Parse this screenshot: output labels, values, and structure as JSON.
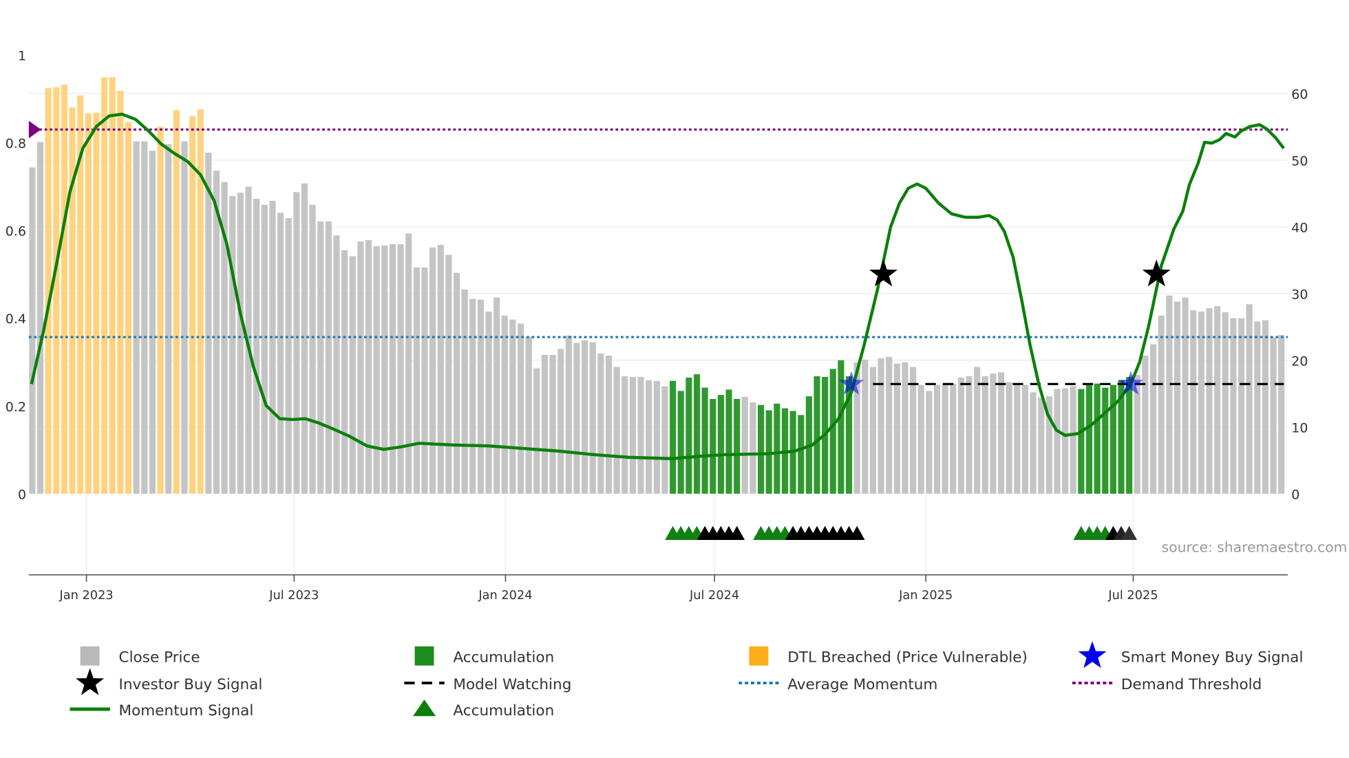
{
  "chart_data": {
    "type": "bar",
    "left_axis": {
      "ticks": [
        "0",
        "0.2",
        "0.4",
        "0.6",
        "0.8",
        "1"
      ],
      "range": [
        0,
        1
      ]
    },
    "right_axis": {
      "ticks": [
        "0",
        "10",
        "20",
        "30",
        "40",
        "50",
        "60"
      ],
      "range": [
        0,
        65.8
      ]
    },
    "x_ticks": [
      {
        "label": "Jan 2023",
        "week": 6.76
      },
      {
        "label": "Jul 2023",
        "week": 32.7
      },
      {
        "label": "Jan 2024",
        "week": 59.1
      },
      {
        "label": "Jul 2024",
        "week": 85.2
      },
      {
        "label": "Jan 2025",
        "week": 111.6
      },
      {
        "label": "Jul 2025",
        "week": 137.5
      }
    ],
    "close_price": [
      48.9,
      52.7,
      60.8,
      60.9,
      61.3,
      57.9,
      59.7,
      57,
      57.1,
      62.4,
      62.4,
      60.4,
      55.7,
      52.8,
      52.8,
      51.4,
      55,
      52.4,
      57.5,
      52.8,
      56.6,
      57.6,
      51.1,
      48.4,
      46.7,
      44.6,
      45.1,
      46,
      44.2,
      43.3,
      43.9,
      42.1,
      41.3,
      45.2,
      46.5,
      43.3,
      40.8,
      40.8,
      38.7,
      36.5,
      35.6,
      37.8,
      38,
      37.1,
      37.2,
      37.4,
      37.4,
      39,
      33.9,
      33.9,
      36.9,
      37.3,
      35.8,
      33.1,
      30.6,
      29.2,
      29.1,
      27.3,
      29.4,
      26.7,
      26.1,
      25.5,
      23.5,
      18.8,
      20.8,
      20.8,
      21.7,
      23.7,
      22.6,
      23,
      22.7,
      21,
      20.7,
      19,
      17.6,
      17.5,
      17.5,
      17,
      16.9,
      16.1,
      16.9,
      15.4,
      17.4,
      17.9,
      15.9,
      14.2,
      14.8,
      15.6,
      14.2,
      14.5,
      13.7,
      13.3,
      12.5,
      13.5,
      12.8,
      12.4,
      11.8,
      14.6,
      17.6,
      17.5,
      18.7,
      20,
      17.6,
      19.7,
      20.1,
      19,
      20.3,
      20.5,
      19.5,
      19.7,
      19,
      16.3,
      15.4,
      16.3,
      16.5,
      16.5,
      17.4,
      17.6,
      19,
      17.6,
      18,
      18.2,
      16.7,
      16.5,
      16.3,
      15.2,
      14.4,
      14.6,
      15.7,
      15.8,
      16.1,
      15.7,
      16.3,
      16.5,
      15.9,
      16.3,
      17,
      17.5,
      17.8,
      20.7,
      22.4,
      26.7,
      29.7,
      28.8,
      29.4,
      27.5,
      27.3,
      27.8,
      28.1,
      27.2,
      26.3,
      26.3,
      28.4,
      25.8,
      26,
      23.4,
      23.8
    ],
    "dtl_breached_weeks": [
      2,
      3,
      4,
      5,
      6,
      7,
      8,
      9,
      10,
      11,
      12,
      16,
      18,
      20,
      21
    ],
    "accumulation_weeks": [
      [
        80,
        88
      ],
      [
        91,
        102
      ],
      [
        131,
        137
      ]
    ],
    "momentum": [
      [
        -0.1,
        0.25
      ],
      [
        1.4,
        0.37
      ],
      [
        3.1,
        0.53
      ],
      [
        4.7,
        0.688
      ],
      [
        6.3,
        0.787
      ],
      [
        8,
        0.837
      ],
      [
        9.6,
        0.861
      ],
      [
        11.2,
        0.865
      ],
      [
        12.9,
        0.853
      ],
      [
        14.5,
        0.827
      ],
      [
        16.1,
        0.797
      ],
      [
        17.8,
        0.775
      ],
      [
        19.4,
        0.757
      ],
      [
        21,
        0.727
      ],
      [
        22.7,
        0.668
      ],
      [
        24.3,
        0.569
      ],
      [
        26,
        0.41
      ],
      [
        27.6,
        0.29
      ],
      [
        29.2,
        0.201
      ],
      [
        30.9,
        0.171
      ],
      [
        32.5,
        0.169
      ],
      [
        34.1,
        0.171
      ],
      [
        35.8,
        0.161
      ],
      [
        37.4,
        0.149
      ],
      [
        39.6,
        0.131
      ],
      [
        41.8,
        0.109
      ],
      [
        43.9,
        0.101
      ],
      [
        46.1,
        0.107
      ],
      [
        48.3,
        0.115
      ],
      [
        50.5,
        0.113
      ],
      [
        52.7,
        0.111
      ],
      [
        57,
        0.109
      ],
      [
        61.4,
        0.103
      ],
      [
        65.8,
        0.097
      ],
      [
        70.1,
        0.089
      ],
      [
        74.5,
        0.083
      ],
      [
        79.9,
        0.08
      ],
      [
        83.2,
        0.085
      ],
      [
        86.5,
        0.089
      ],
      [
        91.9,
        0.091
      ],
      [
        95.2,
        0.097
      ],
      [
        97.4,
        0.111
      ],
      [
        99,
        0.135
      ],
      [
        100.7,
        0.171
      ],
      [
        102.3,
        0.231
      ],
      [
        103.9,
        0.34
      ],
      [
        105.6,
        0.469
      ],
      [
        107.2,
        0.608
      ],
      [
        108.3,
        0.662
      ],
      [
        109.4,
        0.696
      ],
      [
        110.5,
        0.706
      ],
      [
        111.6,
        0.696
      ],
      [
        113.2,
        0.662
      ],
      [
        114.8,
        0.638
      ],
      [
        116.5,
        0.63
      ],
      [
        118.1,
        0.63
      ],
      [
        119.5,
        0.634
      ],
      [
        120.5,
        0.624
      ],
      [
        121.4,
        0.598
      ],
      [
        122.5,
        0.539
      ],
      [
        123.6,
        0.439
      ],
      [
        124.6,
        0.34
      ],
      [
        125.7,
        0.25
      ],
      [
        126.8,
        0.181
      ],
      [
        127.9,
        0.145
      ],
      [
        129,
        0.133
      ],
      [
        130.6,
        0.137
      ],
      [
        132.3,
        0.157
      ],
      [
        133.9,
        0.183
      ],
      [
        135.6,
        0.211
      ],
      [
        137.2,
        0.25
      ],
      [
        138.3,
        0.3
      ],
      [
        139.4,
        0.38
      ],
      [
        141,
        0.519
      ],
      [
        142.6,
        0.604
      ],
      [
        143.7,
        0.644
      ],
      [
        144.5,
        0.704
      ],
      [
        145.6,
        0.753
      ],
      [
        146.4,
        0.801
      ],
      [
        147.3,
        0.799
      ],
      [
        148.3,
        0.807
      ],
      [
        149.1,
        0.821
      ],
      [
        150.2,
        0.813
      ],
      [
        151,
        0.827
      ],
      [
        152.1,
        0.837
      ],
      [
        153.3,
        0.841
      ],
      [
        154.2,
        0.831
      ],
      [
        155.3,
        0.811
      ],
      [
        156.3,
        0.787
      ]
    ],
    "average_momentum": 0.357,
    "demand_threshold": 0.83,
    "model_watching": {
      "level": 0.25,
      "from_week": 105,
      "to_week": 156.3
    },
    "investor_buy_signals": [
      [
        106.3,
        0.5
      ],
      [
        140.4,
        0.5
      ]
    ],
    "smart_money_buy_signals": [
      [
        102.3,
        0.25
      ],
      [
        137.2,
        0.25
      ]
    ],
    "accumulation_markers": [
      {
        "week": 80,
        "color": "#138013"
      },
      {
        "week": 81,
        "color": "#138013"
      },
      {
        "week": 82,
        "color": "#138013"
      },
      {
        "week": 83,
        "color": "#138013"
      },
      {
        "week": 84,
        "color": "#000000"
      },
      {
        "week": 85,
        "color": "#000000"
      },
      {
        "week": 86,
        "color": "#000000"
      },
      {
        "week": 87,
        "color": "#000000"
      },
      {
        "week": 88,
        "color": "#000000"
      },
      {
        "week": 91,
        "color": "#138013"
      },
      {
        "week": 92,
        "color": "#138013"
      },
      {
        "week": 93,
        "color": "#138013"
      },
      {
        "week": 94,
        "color": "#138013"
      },
      {
        "week": 95,
        "color": "#000000"
      },
      {
        "week": 96,
        "color": "#000000"
      },
      {
        "week": 97,
        "color": "#000000"
      },
      {
        "week": 98,
        "color": "#000000"
      },
      {
        "week": 99,
        "color": "#000000"
      },
      {
        "week": 100,
        "color": "#000000"
      },
      {
        "week": 101,
        "color": "#000000"
      },
      {
        "week": 102,
        "color": "#000000"
      },
      {
        "week": 103,
        "color": "#000000"
      },
      {
        "week": 131,
        "color": "#138013"
      },
      {
        "week": 132,
        "color": "#138013"
      },
      {
        "week": 133,
        "color": "#138013"
      },
      {
        "week": 134,
        "color": "#138013"
      },
      {
        "week": 135,
        "color": "#000000"
      },
      {
        "week": 136,
        "color": "#222222"
      },
      {
        "week": 137,
        "color": "#333333"
      }
    ],
    "source": "source: sharemaestro.com",
    "legend": [
      {
        "label": "Close Price",
        "marker": "square",
        "color": "#b9b9b9"
      },
      {
        "label": "Accumulation",
        "marker": "square",
        "color": "#1f8c1f"
      },
      {
        "label": "DTL Breached (Price Vulnerable)",
        "marker": "square",
        "color": "#ffae1a"
      },
      {
        "label": "Smart Money Buy Signal",
        "marker": "star",
        "color": "#0000ee"
      },
      {
        "label": "Investor Buy Signal",
        "marker": "star",
        "color": "#000000"
      },
      {
        "label": "Model Watching",
        "marker": "dash",
        "color": "#000000"
      },
      {
        "label": "Average Momentum",
        "marker": "dot",
        "color": "#1f77b4"
      },
      {
        "label": "Demand Threshold",
        "marker": "dot",
        "color": "#800080"
      },
      {
        "label": "Momentum Signal",
        "marker": "line",
        "color": "#0a800a"
      },
      {
        "label": "Accumulation",
        "marker": "triangle",
        "color": "#0a800a"
      }
    ],
    "colors": {
      "price": "#c4c4c4",
      "dtl": "#ffd27f",
      "accum": "#2e9a2e",
      "momentum": "#0a800a",
      "avg": "#1f77b4",
      "threshold": "#800080"
    }
  }
}
